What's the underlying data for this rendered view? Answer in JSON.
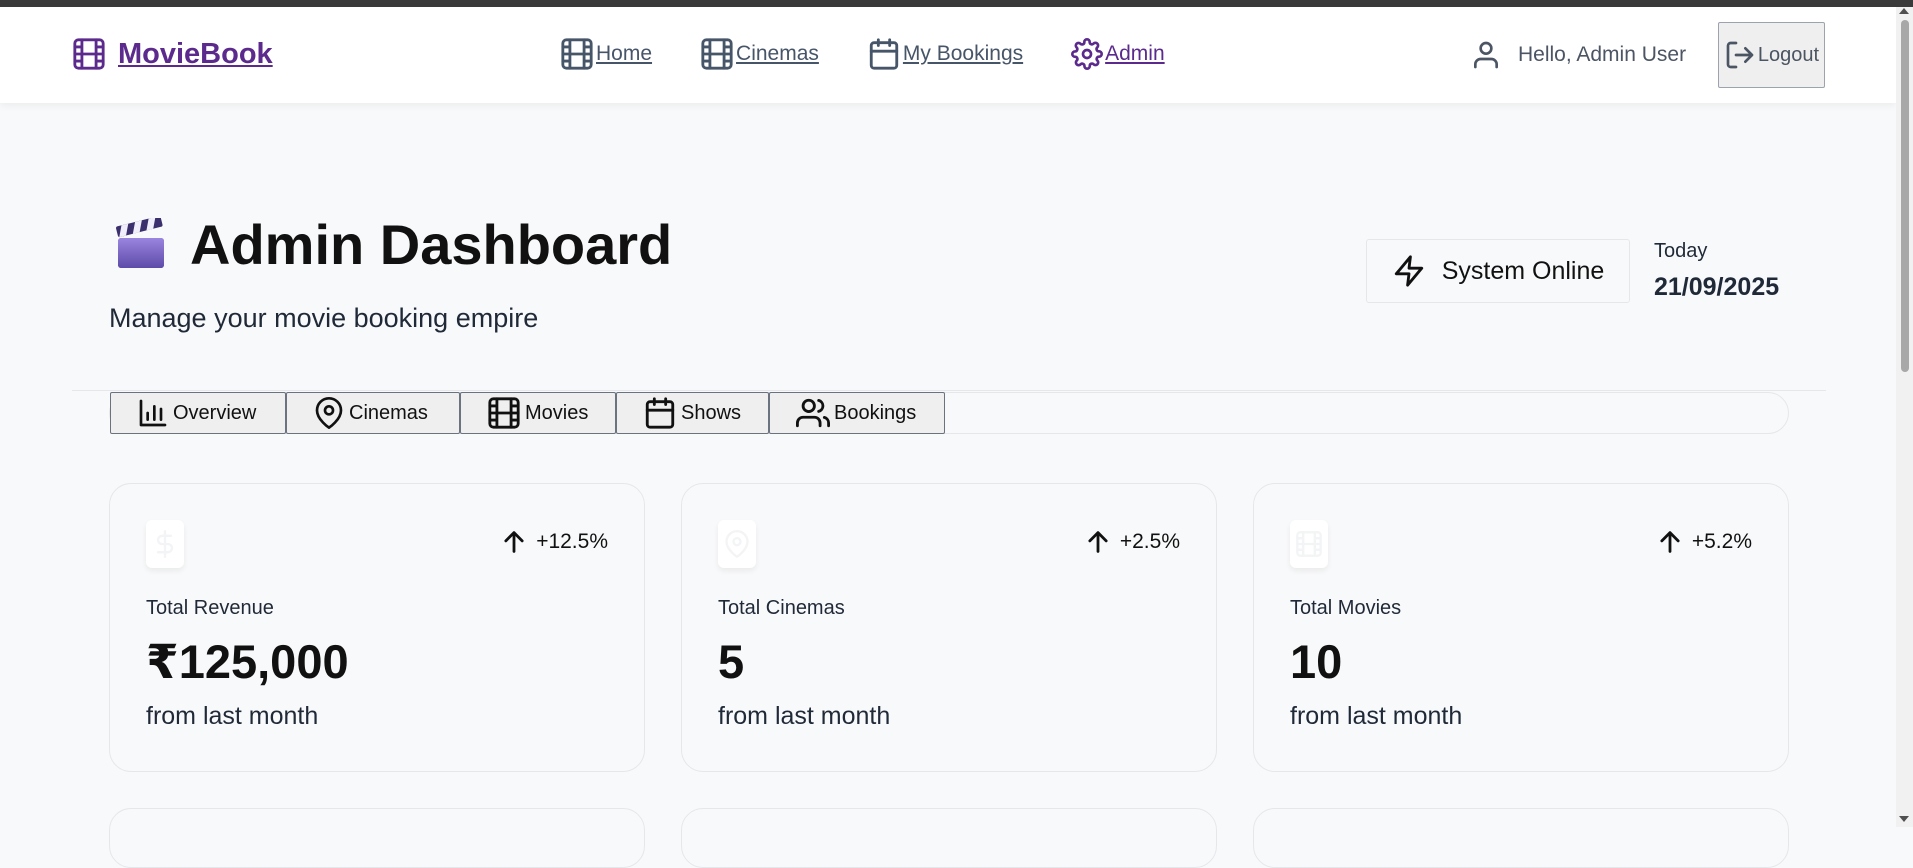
{
  "app": {
    "brand": "MovieBook",
    "brand_icon": "film-icon"
  },
  "nav": {
    "items": [
      {
        "label": "Home",
        "icon": "film-icon"
      },
      {
        "label": "Cinemas",
        "icon": "film-icon"
      },
      {
        "label": "My Bookings",
        "icon": "calendar-icon"
      },
      {
        "label": "Admin",
        "icon": "gear-icon",
        "active": true
      }
    ]
  },
  "user": {
    "greeting": "Hello, Admin User",
    "logout_label": "Logout"
  },
  "page": {
    "emoji": "🎬",
    "title": "Admin Dashboard",
    "subtitle": "Manage your movie booking empire",
    "status": "System Online",
    "date_label": "Today",
    "date_value": "21/09/2025"
  },
  "tabs": [
    {
      "label": "Overview",
      "icon": "bar-chart-icon"
    },
    {
      "label": "Cinemas",
      "icon": "map-pin-icon"
    },
    {
      "label": "Movies",
      "icon": "film-icon"
    },
    {
      "label": "Shows",
      "icon": "calendar-icon"
    },
    {
      "label": "Bookings",
      "icon": "users-icon"
    }
  ],
  "stats": [
    {
      "label": "Total Revenue",
      "value": "₹125,000",
      "change": "+12.5%",
      "sub": "from last month",
      "icon": "dollar-icon"
    },
    {
      "label": "Total Cinemas",
      "value": "5",
      "change": "+2.5%",
      "sub": "from last month",
      "icon": "map-pin-icon"
    },
    {
      "label": "Total Movies",
      "value": "10",
      "change": "+5.2%",
      "sub": "from last month",
      "icon": "film-icon"
    }
  ],
  "colors": {
    "brand": "#5b2a8c",
    "nav_text": "#475569",
    "background": "#f8f9fa",
    "border": "#e5e7eb"
  }
}
